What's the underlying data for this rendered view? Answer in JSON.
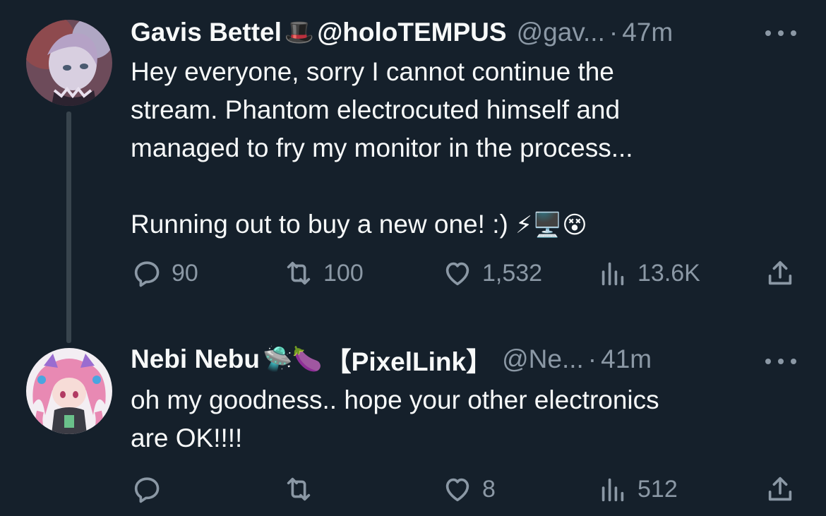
{
  "tweets": [
    {
      "display_name": "Gavis Bettel",
      "name_emoji": "🎩",
      "name_suffix": "@holoTEMPUS",
      "handle": "@gav...",
      "separator": "·",
      "time": "47m",
      "text_lines": [
        "Hey everyone, sorry I cannot continue the",
        "stream. Phantom electrocuted himself and",
        "managed to fry my monitor in the process..."
      ],
      "text_line_4": "Running out to buy a new one! :)",
      "text_emojis": "⚡🖥️😵",
      "actions": {
        "reply_count": "90",
        "repost_count": "100",
        "like_count": "1,532",
        "views_count": "13.6K"
      },
      "icons": [
        "reply-icon",
        "repost-icon",
        "like-icon",
        "views-icon",
        "share-icon",
        "more-icon"
      ]
    },
    {
      "display_name": "Nebi Nebu",
      "name_emoji": "🛸🍆",
      "name_suffix": "【PixelLink】",
      "handle": "@Ne...",
      "separator": "·",
      "time": "41m",
      "text_lines": [
        "oh my goodness.. hope your other electronics",
        "are OK!!!!"
      ],
      "actions": {
        "reply_count": "",
        "repost_count": "",
        "like_count": "8",
        "views_count": "512"
      },
      "icons": [
        "reply-icon",
        "repost-icon",
        "like-icon",
        "views-icon",
        "share-icon",
        "more-icon"
      ]
    }
  ],
  "colors": {
    "background": "#15202b",
    "text": "#f7f9f9",
    "secondary": "#8b98a5",
    "thread_line": "#38444d"
  }
}
